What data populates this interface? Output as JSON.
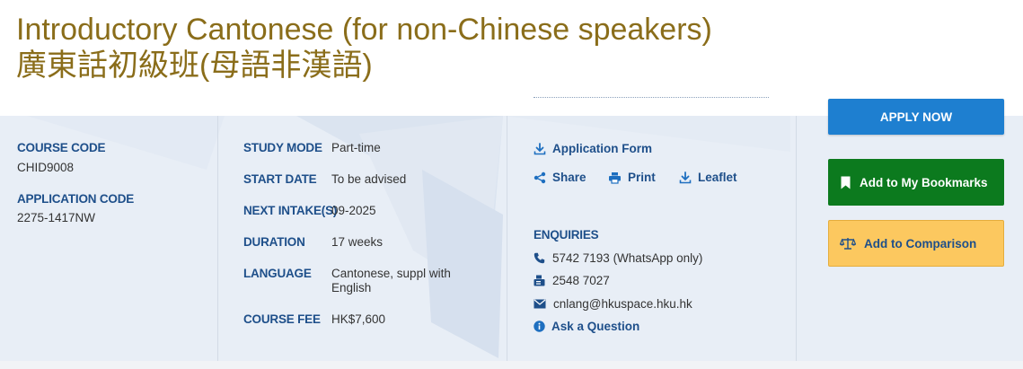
{
  "course": {
    "title_en": "Introductory Cantonese (for non-Chinese speakers)",
    "title_zh": "廣東話初級班(母語非漢語)"
  },
  "codes": {
    "course_code_label": "COURSE CODE",
    "course_code": "CHID9008",
    "application_code_label": "APPLICATION CODE",
    "application_code": "2275-1417NW"
  },
  "details": [
    {
      "label": "STUDY MODE",
      "value": "Part-time"
    },
    {
      "label": "START DATE",
      "value": "To be advised"
    },
    {
      "label": "NEXT INTAKE(S)",
      "value": "09-2025"
    },
    {
      "label": "DURATION",
      "value": "17 weeks"
    },
    {
      "label": "LANGUAGE",
      "value": "Cantonese, suppl with English"
    },
    {
      "label": "COURSE FEE",
      "value": "HK$7,600"
    }
  ],
  "resources": {
    "application_form": "Application Form",
    "share": "Share",
    "print": "Print",
    "leaflet": "Leaflet"
  },
  "enquiries": {
    "label": "ENQUIRIES",
    "whatsapp": "5742 7193 (WhatsApp only)",
    "fax": "2548 7027",
    "email": "cnlang@hkuspace.hku.hk",
    "ask": "Ask a Question"
  },
  "actions": {
    "apply": "APPLY NOW",
    "bookmark": "Add to My Bookmarks",
    "compare": "Add to Comparison"
  },
  "colors": {
    "title": "#8a6d1a",
    "label": "#1e4f8a",
    "apply_button": "#1e7fd0",
    "bookmark_button": "#0c7a1e",
    "compare_button": "#fcc85f"
  },
  "icons": [
    "download-icon",
    "share-icon",
    "print-icon",
    "phone-icon",
    "fax-icon",
    "mail-icon",
    "info-icon",
    "bookmark-icon",
    "scale-icon"
  ]
}
